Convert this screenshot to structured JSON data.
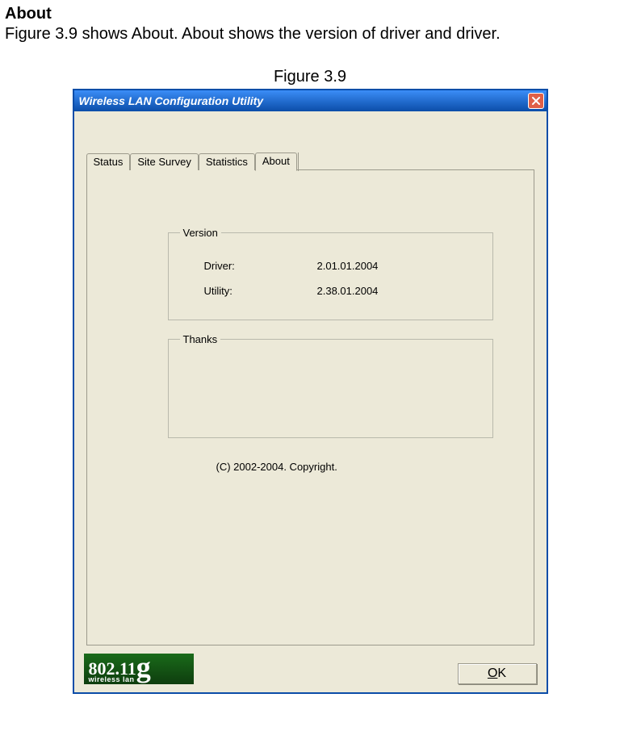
{
  "doc": {
    "heading": "About",
    "paragraph": "Figure 3.9 shows About. About shows the version of driver and driver.",
    "figure_caption": "Figure 3.9"
  },
  "window": {
    "title": "Wireless LAN Configuration Utility",
    "tabs": {
      "status": "Status",
      "site_survey": "Site Survey",
      "statistics": "Statistics",
      "about": "About"
    },
    "about": {
      "version_group": "Version",
      "driver_label": "Driver:",
      "driver_value": "2.01.01.2004",
      "utility_label": "Utility:",
      "utility_value": "2.38.01.2004",
      "thanks_group": "Thanks",
      "copyright": "(C) 2002-2004. Copyright."
    },
    "logo": {
      "top": "802.11",
      "g": "g",
      "sub": "wireless lan"
    },
    "ok_label": "OK",
    "ok_mnemonic_prefix": "O",
    "ok_mnemonic_suffix": "K"
  }
}
